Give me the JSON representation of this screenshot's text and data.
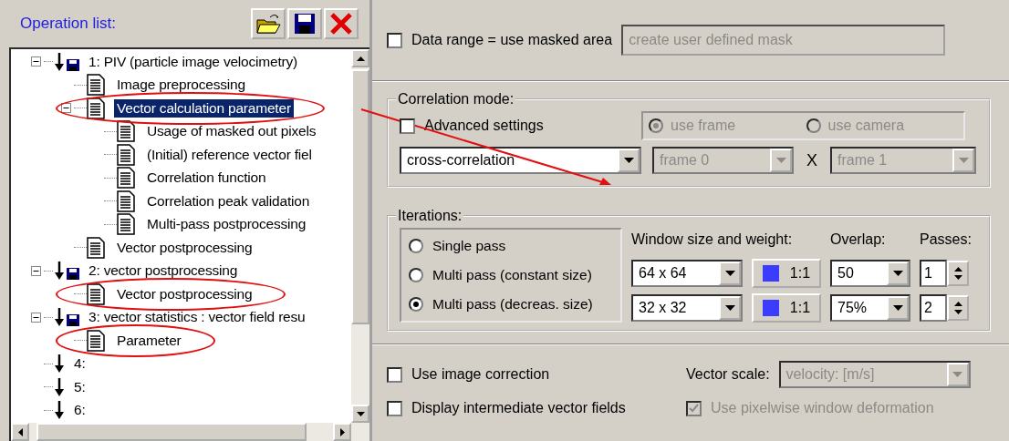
{
  "panel_title": "Operation list:",
  "toolbar": [
    {
      "kind": "open"
    },
    {
      "kind": "save"
    },
    {
      "kind": "delete"
    }
  ],
  "tree": [
    {
      "kind": "operation",
      "label": "1: PIV (particle image velocimetry)",
      "stored": true,
      "expanded": true,
      "selected": false,
      "circled": false,
      "children": [
        {
          "kind": "parameter",
          "label": "Image preprocessing",
          "selected": false,
          "circled": false
        },
        {
          "kind": "parameter",
          "label": "Vector calculation parameter",
          "expanded": true,
          "selected": true,
          "circled": true,
          "children": [
            {
              "kind": "parameter",
              "label": "Usage of masked out pixels",
              "selected": false,
              "circled": false
            },
            {
              "kind": "parameter",
              "label": "(Initial) reference vector fiel",
              "selected": false,
              "circled": false
            },
            {
              "kind": "parameter",
              "label": "Correlation function",
              "selected": false,
              "circled": false
            },
            {
              "kind": "parameter",
              "label": "Correlation peak validation",
              "selected": false,
              "circled": false
            },
            {
              "kind": "parameter",
              "label": "Multi-pass postprocessing",
              "selected": false,
              "circled": false
            }
          ]
        },
        {
          "kind": "parameter",
          "label": "Vector postprocessing",
          "selected": false,
          "circled": false
        }
      ]
    },
    {
      "kind": "operation",
      "label": "2: vector postprocessing",
      "stored": true,
      "expanded": true,
      "selected": false,
      "circled": false,
      "children": [
        {
          "kind": "parameter",
          "label": "Vector postprocessing",
          "selected": false,
          "circled": true
        }
      ]
    },
    {
      "kind": "operation",
      "label": "3: vector statistics : vector field resu",
      "stored": true,
      "expanded": true,
      "selected": false,
      "circled": false,
      "children": [
        {
          "kind": "parameter",
          "label": "Parameter",
          "selected": false,
          "circled": true
        }
      ]
    },
    {
      "kind": "operation",
      "label": "4:",
      "stored": false,
      "selected": false,
      "circled": false
    },
    {
      "kind": "operation",
      "label": "5:",
      "stored": false,
      "selected": false,
      "circled": false
    },
    {
      "kind": "operation",
      "label": "6:",
      "stored": false,
      "selected": false,
      "circled": false
    }
  ],
  "annotation_arrow": true,
  "data_range": {
    "label": "Data range = use masked area",
    "checked": false,
    "mask_button": {
      "label": "create user defined mask",
      "disabled": true
    }
  },
  "correlation_mode": {
    "title": "Correlation mode:",
    "advanced": {
      "label": "Advanced settings",
      "checked": false
    },
    "source": {
      "disabled": true,
      "options": [
        {
          "label": "use frame",
          "selected": true
        },
        {
          "label": "use camera",
          "selected": false
        }
      ]
    },
    "function": {
      "value": "cross-correlation",
      "disabled": false
    },
    "frame_a": {
      "value": "frame 0",
      "disabled": true
    },
    "times": "X",
    "frame_b": {
      "value": "frame 1",
      "disabled": true
    }
  },
  "iterations": {
    "title": "Iterations:",
    "modes": [
      {
        "label": "Single pass",
        "selected": false
      },
      {
        "label": "Multi pass (constant size)",
        "selected": false
      },
      {
        "label": "Multi pass (decreas. size)",
        "selected": true
      }
    ],
    "headers": {
      "window": "Window size and weight:",
      "overlap": "Overlap:",
      "passes": "Passes:"
    },
    "rows": [
      {
        "window": "64 x 64",
        "weight": "1:1",
        "overlap": "50",
        "passes": "1"
      },
      {
        "window": "32 x 32",
        "weight": "1:1",
        "overlap": "75%",
        "passes": "2"
      }
    ]
  },
  "options": {
    "image_correction": {
      "label": "Use image correction",
      "checked": false
    },
    "vector_scale": {
      "label": "Vector scale:",
      "value": "velocity: [m/s]",
      "disabled": true
    },
    "intermediate": {
      "label": "Display intermediate vector fields",
      "checked": false
    },
    "pixelwise": {
      "label": "Use pixelwise window deformation",
      "checked": true,
      "disabled": true
    }
  }
}
